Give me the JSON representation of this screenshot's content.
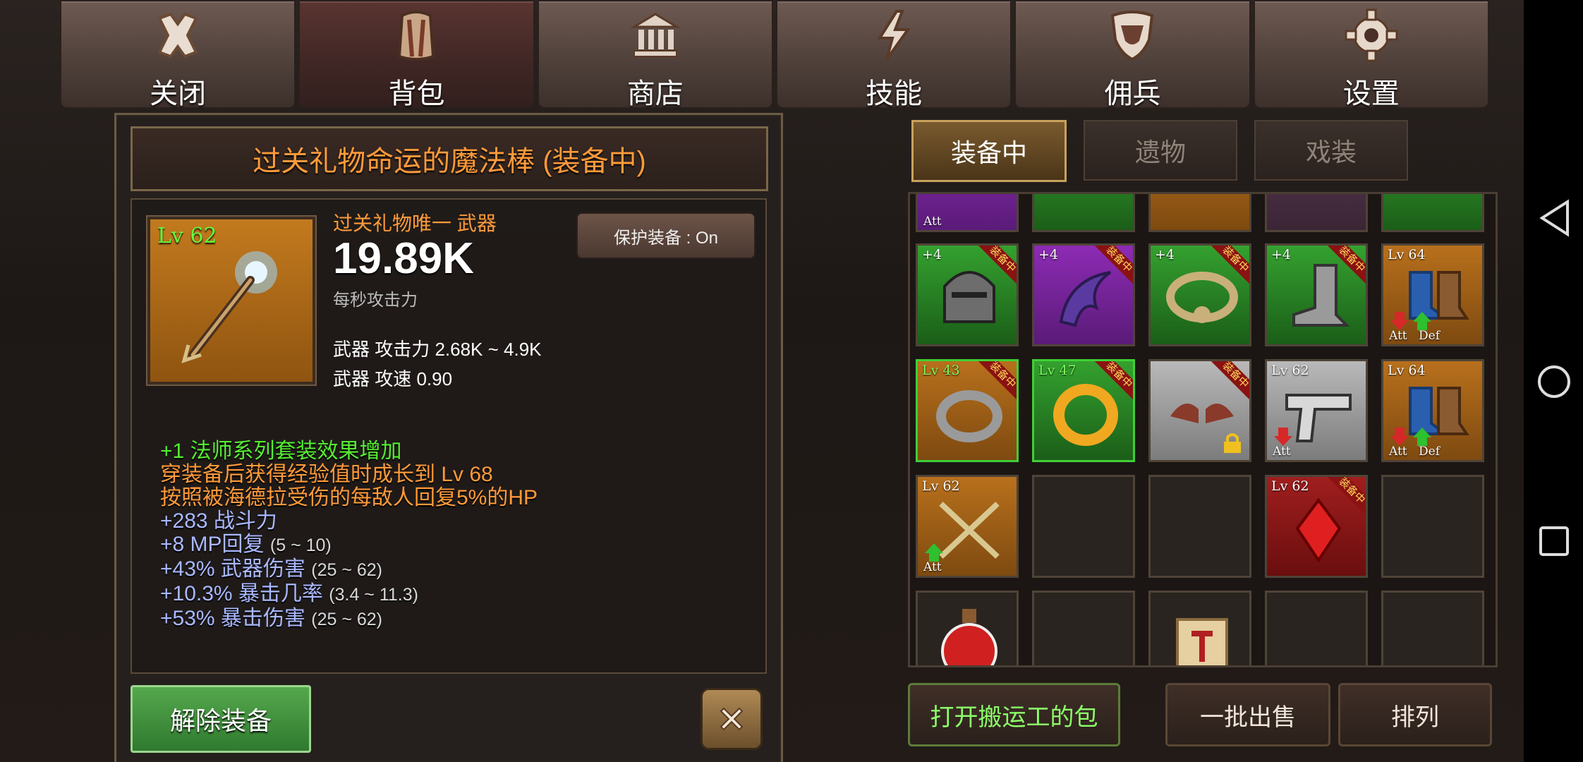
{
  "nav": [
    {
      "label": "关闭",
      "icon": "close-icon"
    },
    {
      "label": "背包",
      "icon": "backpack-icon"
    },
    {
      "label": "商店",
      "icon": "shop-icon"
    },
    {
      "label": "技能",
      "icon": "lightning-icon"
    },
    {
      "label": "佣兵",
      "icon": "shield-icon"
    },
    {
      "label": "设置",
      "icon": "gear-icon"
    }
  ],
  "detail": {
    "title": "过关礼物命运的魔法棒 (装备中)",
    "level": "Lv 62",
    "subtitle": "过关礼物唯一 武器",
    "value": "19.89K",
    "value_label": "每秒攻击力",
    "protect": "保护装备 : On",
    "stat1": "武器 攻击力 2.68K ~ 4.9K",
    "stat2": "武器 攻速 0.90",
    "effects": [
      {
        "text": "+1 法师系列套装效果增加",
        "range": "",
        "color": "green"
      },
      {
        "text": "穿装备后获得经验值时成长到 Lv 68",
        "range": "",
        "color": "orange"
      },
      {
        "text": "按照被海德拉受伤的每敌人回复5%的HP",
        "range": "",
        "color": "orange"
      },
      {
        "text": "+283 战斗力",
        "range": "",
        "color": "blue"
      },
      {
        "text": "+8 MP回复",
        "range": "(5 ~ 10)",
        "color": "blue"
      },
      {
        "text": "+43% 武器伤害",
        "range": "(25 ~ 62)",
        "color": "blue"
      },
      {
        "text": "+10.3% 暴击几率",
        "range": "(3.4 ~ 11.3)",
        "color": "blue"
      },
      {
        "text": "+53% 暴击伤害",
        "range": "(25 ~ 62)",
        "color": "blue"
      }
    ],
    "unequip": "解除装备"
  },
  "inventory": {
    "tabs": [
      {
        "label": "装备中",
        "active": true
      },
      {
        "label": "遗物",
        "active": false
      },
      {
        "label": "戏装",
        "active": false
      }
    ],
    "row0": [
      {
        "bg": "purple",
        "att": "Att"
      },
      {
        "bg": "green"
      },
      {
        "bg": "orange"
      },
      {
        "bg": "purple"
      },
      {
        "bg": "green"
      }
    ],
    "row1": [
      {
        "bg": "green",
        "tl": "+4",
        "ribbon": "装备中",
        "icon": "helmet-icon"
      },
      {
        "bg": "purple",
        "tl": "+4",
        "ribbon": "装备中",
        "icon": "claw-icon"
      },
      {
        "bg": "green",
        "tl": "+4",
        "ribbon": "装备中",
        "icon": "amulet-icon"
      },
      {
        "bg": "green",
        "tl": "+4",
        "ribbon": "装备中",
        "icon": "boot-icon"
      },
      {
        "bg": "orange",
        "tl": "Lv 64",
        "att": "Att",
        "def": "Def",
        "icon": "boots-icon"
      }
    ],
    "row2": [
      {
        "bg": "orange",
        "tl": "Lv 43",
        "ribbon": "装备中",
        "icon": "ring-icon",
        "hl": true
      },
      {
        "bg": "green",
        "tl": "Lv 47",
        "ribbon": "装备中",
        "icon": "gold-ring-icon",
        "hl": true
      },
      {
        "bg": "gray",
        "ribbon": "装备中",
        "icon": "wings-icon",
        "lock": true
      },
      {
        "bg": "gray",
        "tl": "Lv 62",
        "att": "Att",
        "icon": "pistol-icon"
      },
      {
        "bg": "orange",
        "tl": "Lv 64",
        "att": "Att",
        "def": "Def",
        "icon": "boots-icon"
      }
    ],
    "row3": [
      {
        "bg": "orange",
        "tl": "Lv 62",
        "att": "Att",
        "icon": "swords-icon"
      },
      {
        "bg": "empty"
      },
      {
        "bg": "empty"
      },
      {
        "bg": "red",
        "tl": "Lv 62",
        "ribbon": "装备中",
        "icon": "gem-icon"
      },
      {
        "bg": "empty"
      }
    ],
    "row4": [
      {
        "bg": "empty",
        "icon": "potion-icon"
      },
      {
        "bg": "empty"
      },
      {
        "bg": "empty",
        "icon": "scroll-icon"
      },
      {
        "bg": "empty"
      },
      {
        "bg": "empty"
      }
    ],
    "buttons": {
      "porter": "打开搬运工的包",
      "bulk_sell": "一批出售",
      "sort": "排列"
    }
  }
}
